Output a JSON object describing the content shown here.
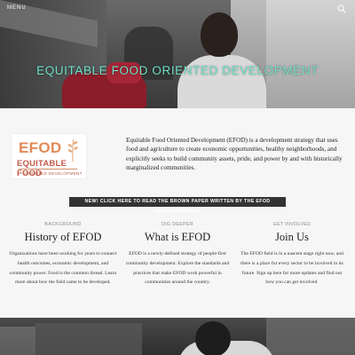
{
  "header": {
    "menu_label": "MENU",
    "menu_icon": "hamburger-icon",
    "search_icon": "search-icon",
    "hero_title": "EQUITABLE FOOD ORIENTED DEVELOPMENT",
    "hero_title_color": "#6fe0c6"
  },
  "logo": {
    "line1": "EFOD",
    "line2": "EQUITABLE FOOD",
    "line3": "ORIENTED DEVELOPMENT"
  },
  "intro": {
    "text": "Equitable Food Oriented Development (EFOD) is a development strategy that uses food and agriculture to create economic opportunities, healthy neighborhoods, and explicitly seeks to build community assets, pride, and power by and with historically marginalized communities."
  },
  "cta": {
    "label": "NEW! CLICK HERE TO READ THE BROWN PAPER WRITTEN BY THE EFOD COLLABORATIVE."
  },
  "columns": [
    {
      "eyebrow": "BACKGROUND",
      "title": "History of EFOD",
      "body": "Organizations have been working for years to connect health outcomes, economic development, and community power. Food is the common thread. Learn more about how the field came to be developed."
    },
    {
      "eyebrow": "DIG DEEPER",
      "title": "What is EFOD",
      "body": "EFOD is a newly-defined strategy of people-first community development. Explore the standards and practices that make EFOD work powerful in communities around the country."
    },
    {
      "eyebrow": "GET INVOLVED",
      "title": "Join Us",
      "body": "The EFOD field is in a nascent stage right now, and there is a place for every sector to be involved in its future. Sign up here for more updates and find out how you can get involved."
    }
  ]
}
